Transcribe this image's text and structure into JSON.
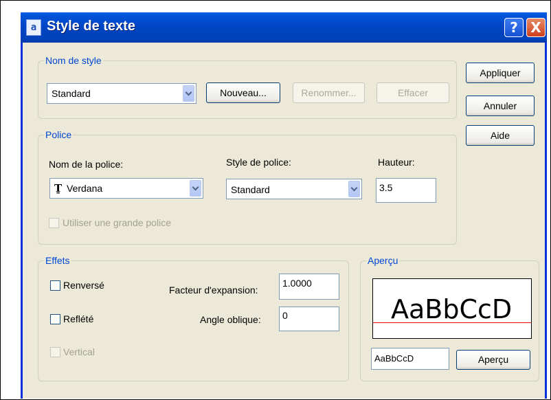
{
  "window": {
    "title": "Style de texte",
    "help_label": "?",
    "close_label": "X"
  },
  "style_name": {
    "legend": "Nom de style",
    "selected": "Standard",
    "new_label": "Nouveau...",
    "rename_label": "Renommer...",
    "delete_label": "Effacer"
  },
  "actions": {
    "apply_label": "Appliquer",
    "cancel_label": "Annuler",
    "help_label": "Aide"
  },
  "font": {
    "legend": "Police",
    "font_name_label": "Nom de la police:",
    "font_name_icon": "Ṯ",
    "font_name_value": "Verdana",
    "font_style_label": "Style de police:",
    "font_style_value": "Standard",
    "height_label": "Hauteur:",
    "height_value": "3.5",
    "big_font_label": "Utiliser une grande police"
  },
  "effects": {
    "legend": "Effets",
    "upside_down_label": "Renversé",
    "backwards_label": "Reflété",
    "vertical_label": "Vertical",
    "width_factor_label": "Facteur d'expansion:",
    "width_factor_value": "1.0000",
    "oblique_label": "Angle oblique:",
    "oblique_value": "0"
  },
  "preview": {
    "legend": "Aperçu",
    "sample_text": "AaBbCcD",
    "input_value": "AaBbCcD",
    "button_label": "Aperçu"
  },
  "colors": {
    "title_bar": "#0045c4",
    "legend_blue": "#0046d5",
    "dialog_bg": "#ece9d8",
    "baseline_red": "#e00000"
  },
  "icons": [
    "text-style-icon",
    "help-icon",
    "close-icon",
    "truetype-font-icon",
    "chevron-down-icon"
  ]
}
